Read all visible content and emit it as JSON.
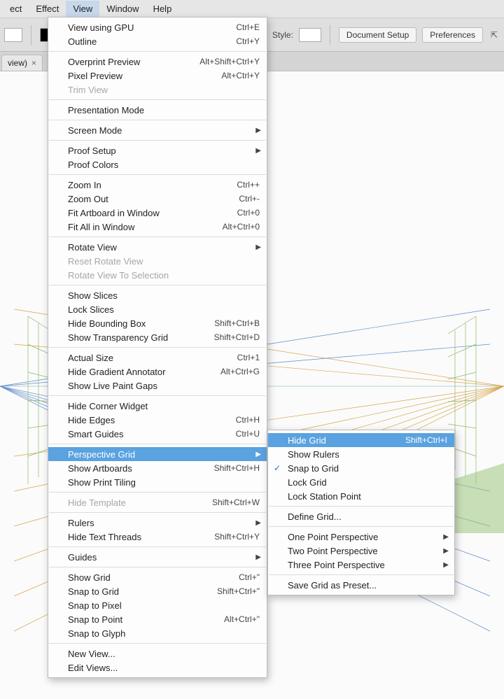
{
  "menubar": {
    "items": [
      "ect",
      "Effect",
      "View",
      "Window",
      "Help"
    ],
    "active_index": 2
  },
  "toolbar": {
    "style_label": "Style:",
    "doc_setup": "Document Setup",
    "preferences": "Preferences"
  },
  "tab": {
    "label": "view)",
    "close": "×"
  },
  "viewMenu": {
    "groups": [
      [
        {
          "label": "View using GPU",
          "shortcut": "Ctrl+E"
        },
        {
          "label": "Outline",
          "shortcut": "Ctrl+Y"
        }
      ],
      [
        {
          "label": "Overprint Preview",
          "shortcut": "Alt+Shift+Ctrl+Y"
        },
        {
          "label": "Pixel Preview",
          "shortcut": "Alt+Ctrl+Y"
        },
        {
          "label": "Trim View",
          "disabled": true
        }
      ],
      [
        {
          "label": "Presentation Mode"
        }
      ],
      [
        {
          "label": "Screen Mode",
          "submenu": true
        }
      ],
      [
        {
          "label": "Proof Setup",
          "submenu": true
        },
        {
          "label": "Proof Colors"
        }
      ],
      [
        {
          "label": "Zoom In",
          "shortcut": "Ctrl++"
        },
        {
          "label": "Zoom Out",
          "shortcut": "Ctrl+-"
        },
        {
          "label": "Fit Artboard in Window",
          "shortcut": "Ctrl+0"
        },
        {
          "label": "Fit All in Window",
          "shortcut": "Alt+Ctrl+0"
        }
      ],
      [
        {
          "label": "Rotate View",
          "submenu": true
        },
        {
          "label": "Reset Rotate View",
          "disabled": true
        },
        {
          "label": "Rotate View To Selection",
          "disabled": true
        }
      ],
      [
        {
          "label": "Show Slices"
        },
        {
          "label": "Lock Slices"
        },
        {
          "label": "Hide Bounding Box",
          "shortcut": "Shift+Ctrl+B"
        },
        {
          "label": "Show Transparency Grid",
          "shortcut": "Shift+Ctrl+D"
        }
      ],
      [
        {
          "label": "Actual Size",
          "shortcut": "Ctrl+1"
        },
        {
          "label": "Hide Gradient Annotator",
          "shortcut": "Alt+Ctrl+G"
        },
        {
          "label": "Show Live Paint Gaps"
        }
      ],
      [
        {
          "label": "Hide Corner Widget"
        },
        {
          "label": "Hide Edges",
          "shortcut": "Ctrl+H"
        },
        {
          "label": "Smart Guides",
          "shortcut": "Ctrl+U"
        }
      ],
      [
        {
          "label": "Perspective Grid",
          "submenu": true,
          "highlight": true
        },
        {
          "label": "Show Artboards",
          "shortcut": "Shift+Ctrl+H"
        },
        {
          "label": "Show Print Tiling"
        }
      ],
      [
        {
          "label": "Hide Template",
          "shortcut": "Shift+Ctrl+W",
          "disabled": true
        }
      ],
      [
        {
          "label": "Rulers",
          "submenu": true
        },
        {
          "label": "Hide Text Threads",
          "shortcut": "Shift+Ctrl+Y"
        }
      ],
      [
        {
          "label": "Guides",
          "submenu": true
        }
      ],
      [
        {
          "label": "Show Grid",
          "shortcut": "Ctrl+\""
        },
        {
          "label": "Snap to Grid",
          "shortcut": "Shift+Ctrl+\""
        },
        {
          "label": "Snap to Pixel"
        },
        {
          "label": "Snap to Point",
          "shortcut": "Alt+Ctrl+\""
        },
        {
          "label": "Snap to Glyph"
        }
      ],
      [
        {
          "label": "New View..."
        },
        {
          "label": "Edit Views..."
        }
      ]
    ]
  },
  "pgridMenu": {
    "groups": [
      [
        {
          "label": "Hide Grid",
          "shortcut": "Shift+Ctrl+I",
          "highlight": true
        },
        {
          "label": "Show Rulers"
        },
        {
          "label": "Snap to Grid",
          "checked": true
        },
        {
          "label": "Lock Grid"
        },
        {
          "label": "Lock Station Point"
        }
      ],
      [
        {
          "label": "Define Grid..."
        }
      ],
      [
        {
          "label": "One Point Perspective",
          "submenu": true
        },
        {
          "label": "Two Point Perspective",
          "submenu": true
        },
        {
          "label": "Three Point Perspective",
          "submenu": true
        }
      ],
      [
        {
          "label": "Save Grid as Preset..."
        }
      ]
    ]
  }
}
